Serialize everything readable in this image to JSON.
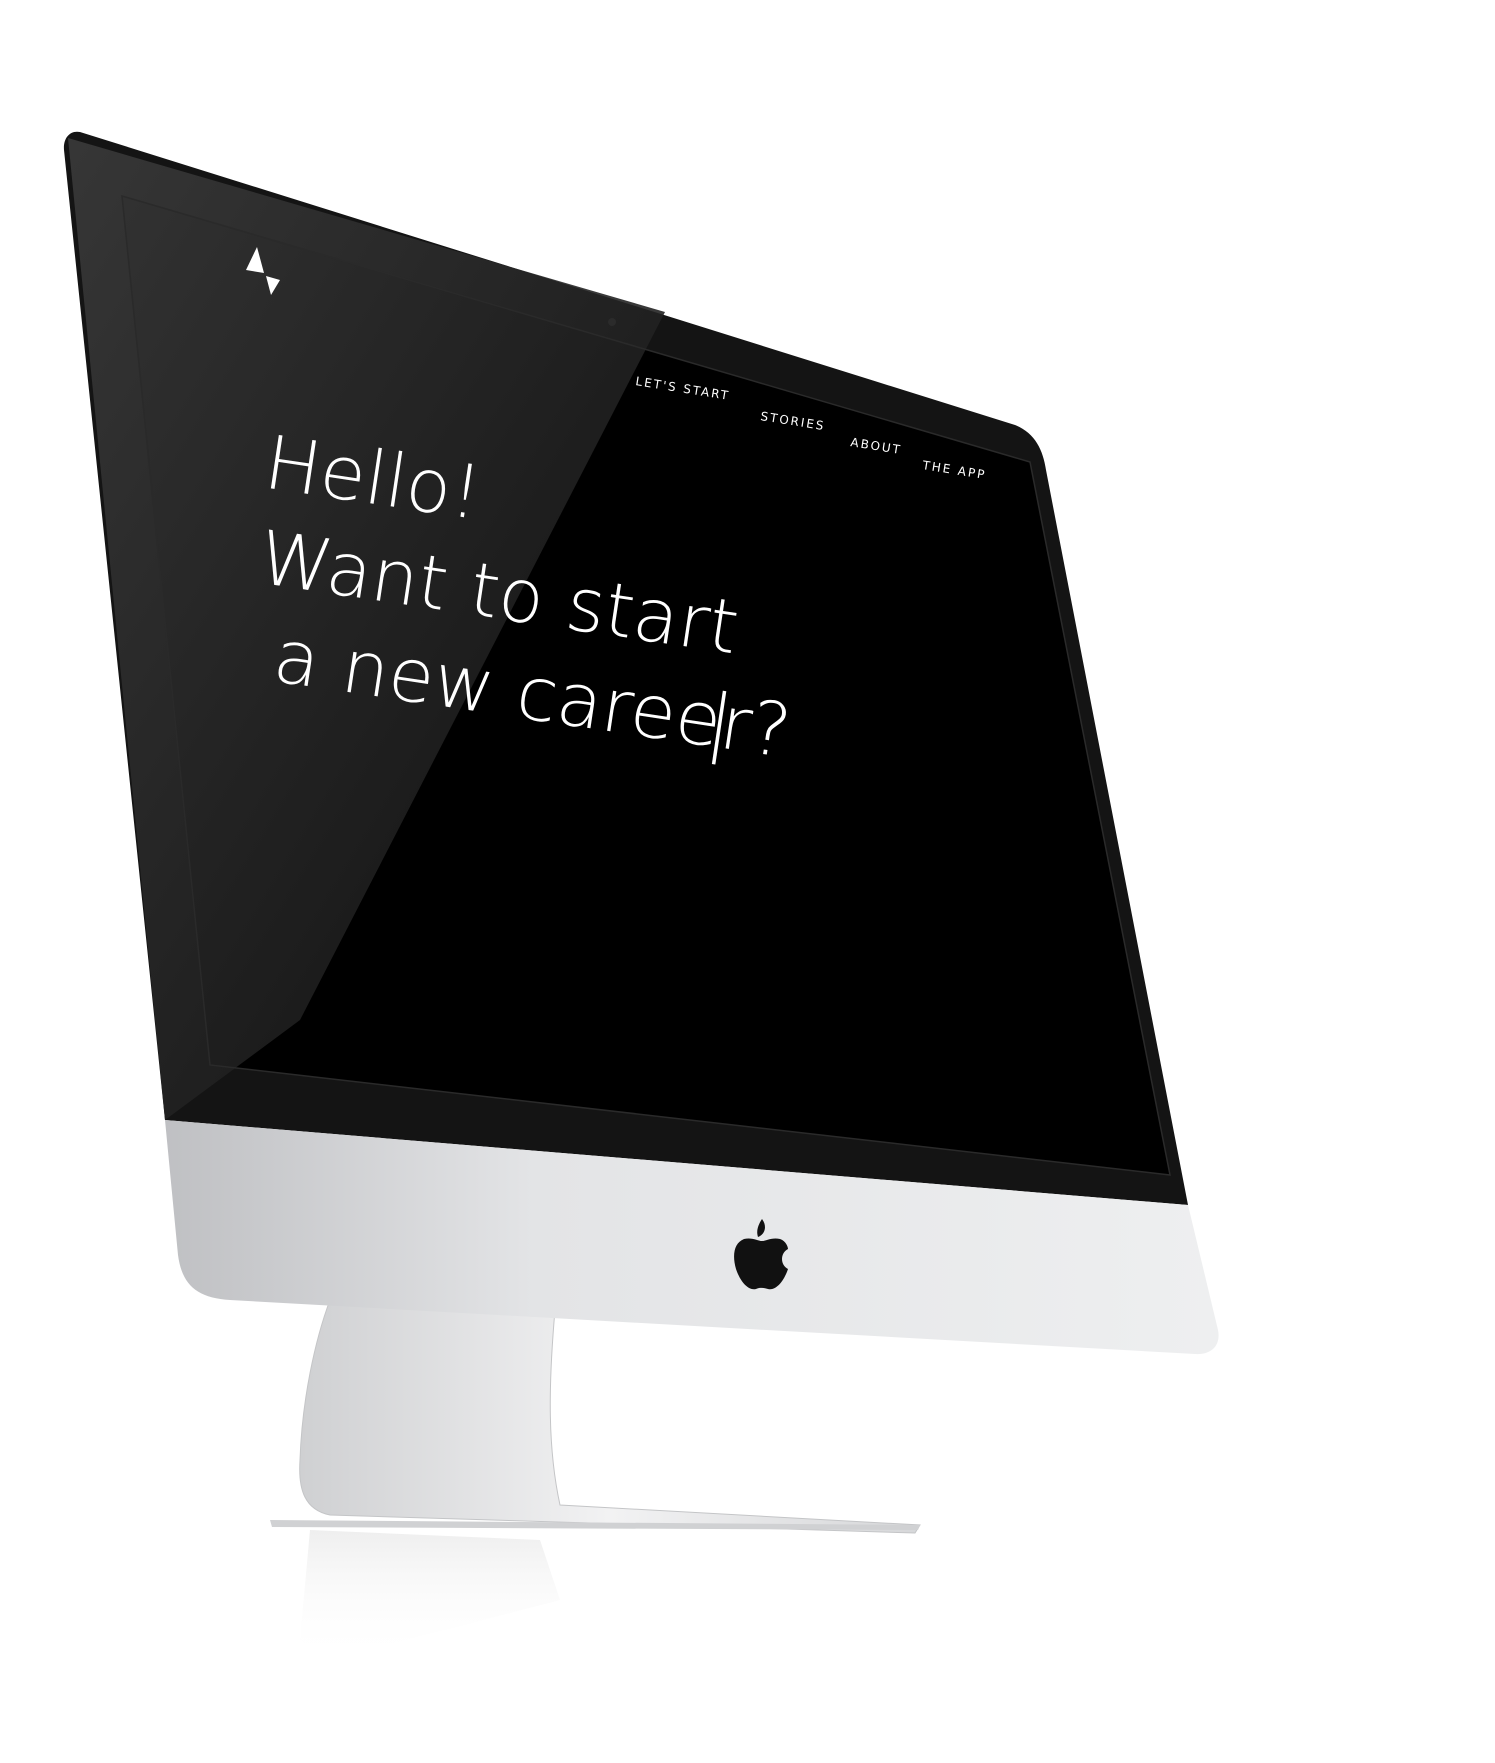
{
  "site": {
    "logo_icon": "hourglass-triangle-logo-icon"
  },
  "nav": {
    "items": [
      {
        "label": "LET'S START"
      },
      {
        "label": "STORIES"
      },
      {
        "label": "ABOUT"
      },
      {
        "label": "THE APP"
      }
    ]
  },
  "hero": {
    "line1": "Hello!",
    "line2": "Want to start",
    "line3": " a new career?",
    "cursor": "|"
  },
  "device": {
    "brand_icon": "apple-logo-icon",
    "colors": {
      "screen": "#000000",
      "bezel": "#1c1c1c",
      "chin": "#e6e7e9",
      "stand": "#d9dadc"
    }
  }
}
